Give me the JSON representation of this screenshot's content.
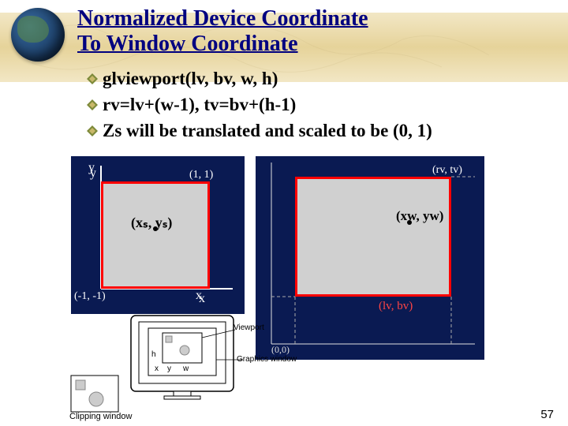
{
  "title_line1": "Normalized Device Coordinate",
  "title_line2": " To Window Coordinate",
  "bullets": [
    "glviewport(lv, bv, w, h)",
    "rv=lv+(w-1), tv=bv+(h-1)",
    "Zs will be translated and scaled to be (0, 1)"
  ],
  "diag_left": {
    "corner_tr": "(1, 1)",
    "corner_bl": "(-1, -1)",
    "point": "(xₛ, yₛ)",
    "axis_y": "y",
    "axis_x": "x"
  },
  "diag_right": {
    "corner_tr": "(rv, tv)",
    "corner_bl": "(lv, bv)",
    "point": "(xw, yw)",
    "origin": "(0,0)"
  },
  "monitor": {
    "axis_h": "h",
    "axis_w": "w",
    "axis_x": "x",
    "axis_y": "y",
    "label_viewport": "Viewport",
    "label_gfx": "Graphics window",
    "footer": "Clipping window"
  },
  "page_number": "57"
}
